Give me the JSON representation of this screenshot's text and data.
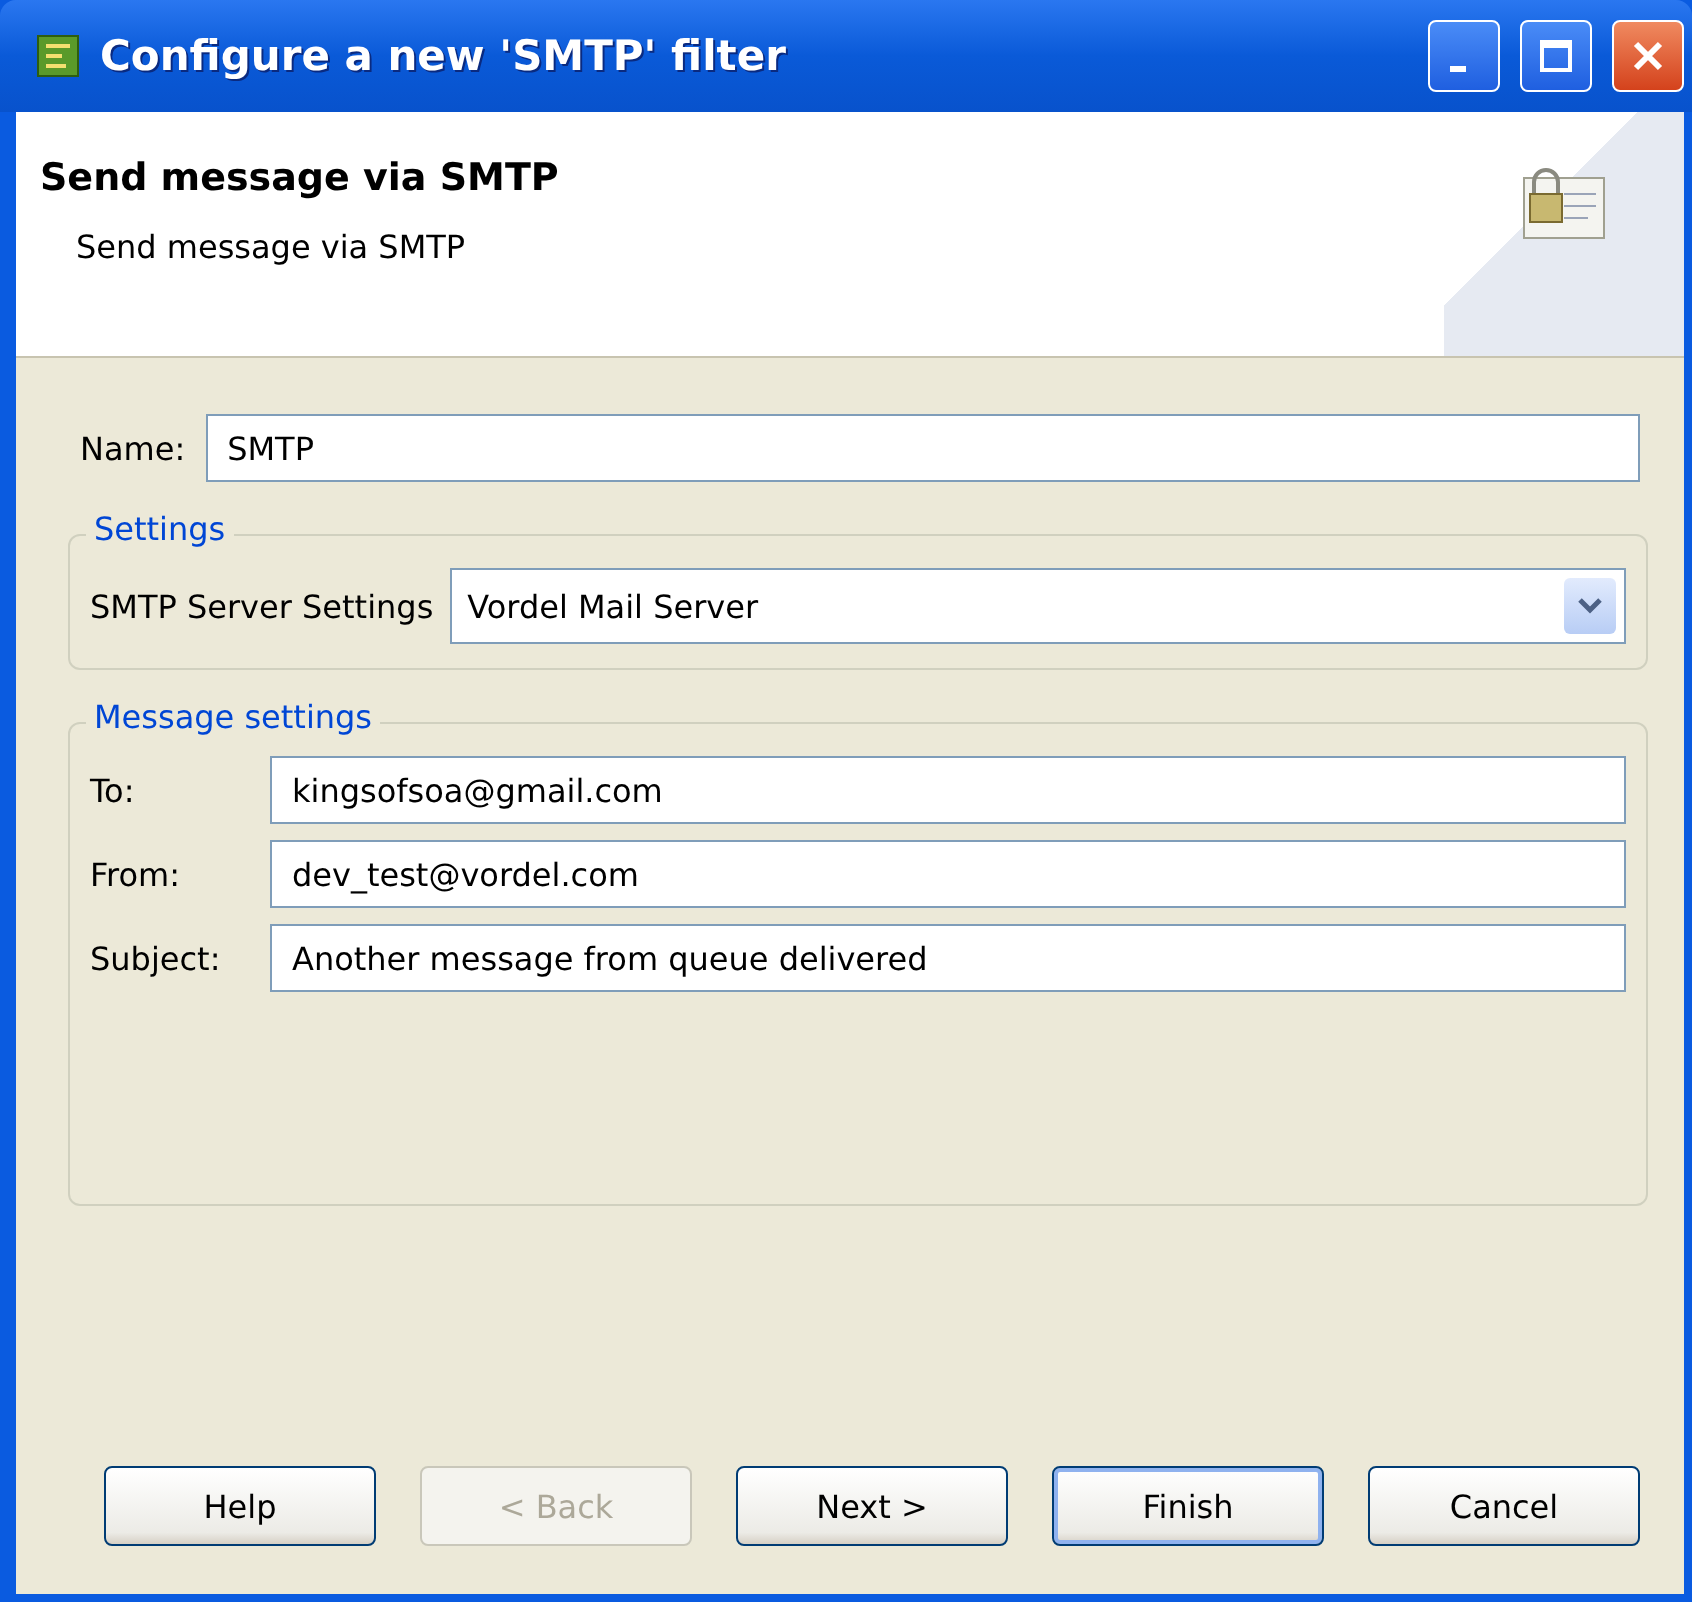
{
  "window": {
    "title": "Configure a new 'SMTP' filter"
  },
  "header": {
    "title": "Send message via SMTP",
    "description": "Send message via SMTP"
  },
  "name_field": {
    "label": "Name:",
    "value": "SMTP"
  },
  "settings": {
    "legend": "Settings",
    "label": "SMTP Server Settings",
    "value": "Vordel Mail Server"
  },
  "message_settings": {
    "legend": "Message settings",
    "fields": [
      {
        "label": "To:",
        "value": "kingsofsoa@gmail.com"
      },
      {
        "label": "From:",
        "value": "dev_test@vordel.com"
      },
      {
        "label": "Subject:",
        "value": "Another message from queue delivered"
      }
    ]
  },
  "buttons": [
    {
      "label": "Help",
      "disabled": false,
      "default": false
    },
    {
      "label": "< Back",
      "disabled": true,
      "default": false
    },
    {
      "label": "Next >",
      "disabled": false,
      "default": false
    },
    {
      "label": "Finish",
      "disabled": false,
      "default": true
    },
    {
      "label": "Cancel",
      "disabled": false,
      "default": false
    }
  ]
}
